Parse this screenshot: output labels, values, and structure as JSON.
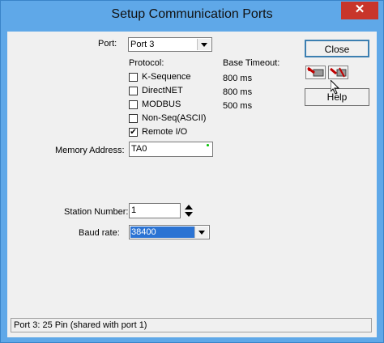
{
  "window": {
    "title": "Setup Communication Ports",
    "close_glyph": "✕"
  },
  "port": {
    "label": "Port:",
    "value": "Port 3"
  },
  "protocol": {
    "header": "Protocol:",
    "timeout_header": "Base Timeout:",
    "items": [
      {
        "label": "K-Sequence",
        "checked": false,
        "timeout": "800 ms"
      },
      {
        "label": "DirectNET",
        "checked": false,
        "timeout": "800 ms"
      },
      {
        "label": "MODBUS",
        "checked": false,
        "timeout": "500 ms"
      },
      {
        "label": "Non-Seq(ASCII)",
        "checked": false,
        "timeout": ""
      },
      {
        "label": "Remote I/O",
        "checked": true,
        "timeout": ""
      }
    ],
    "check_glyph": "✔"
  },
  "memory_address": {
    "label": "Memory Address:",
    "value": "TA0"
  },
  "station": {
    "label": "Station Number:",
    "value": "1"
  },
  "baud": {
    "label": "Baud rate:",
    "value": "38400"
  },
  "buttons": {
    "close": "Close",
    "help": "Help"
  },
  "icons": {
    "connect": "port-connect-icon",
    "disconnect": "port-disconnect-icon"
  },
  "status": {
    "text": "Port 3: 25 Pin (shared with port 1)"
  },
  "colors": {
    "title_bar": "#5fa8e8",
    "close_button": "#c8352b",
    "selection": "#2b73d3",
    "indicator": "#00c000"
  }
}
